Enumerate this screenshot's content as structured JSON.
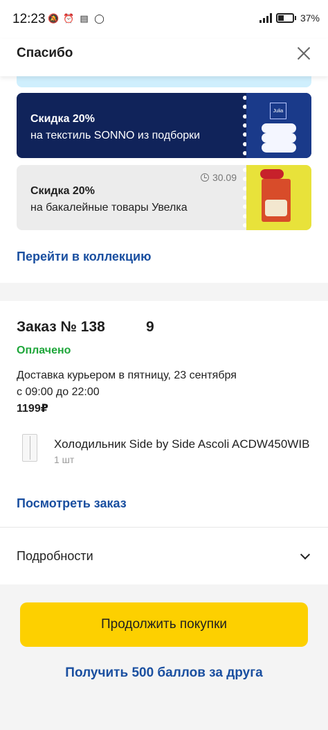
{
  "status_bar": {
    "time": "12:23",
    "battery_percent": "37%"
  },
  "header": {
    "title": "Спасибо"
  },
  "coupons": [
    {
      "title": "Скидка 20%",
      "subtitle": "на текстиль SONNO из подборки",
      "image_label": "Julia",
      "bg_color": "#10235a"
    },
    {
      "title": "Скидка 20%",
      "subtitle": "на бакалейные товары Увелка",
      "expiry": "30.09",
      "bg_color": "#ececec"
    }
  ],
  "collection_link": "Перейти в коллекцию",
  "order": {
    "title": "Заказ № 138",
    "digit": "9",
    "status": "Оплачено",
    "delivery_line1": "Доставка курьером в пятницу, 23 сентября",
    "delivery_line2": "с 09:00 до 22:00",
    "price": "1199₽",
    "item": {
      "name": "Холодильник Side by Side Ascoli ACDW450WIB",
      "quantity": "1 шт"
    },
    "view_link": "Посмотреть заказ"
  },
  "details": {
    "label": "Подробности"
  },
  "actions": {
    "continue_label": "Продолжить покупки",
    "friend_link": "Получить 500 баллов за друга"
  },
  "colors": {
    "accent_yellow": "#fdd000",
    "link_blue": "#1a4fa0",
    "paid_green": "#1ea63a"
  }
}
